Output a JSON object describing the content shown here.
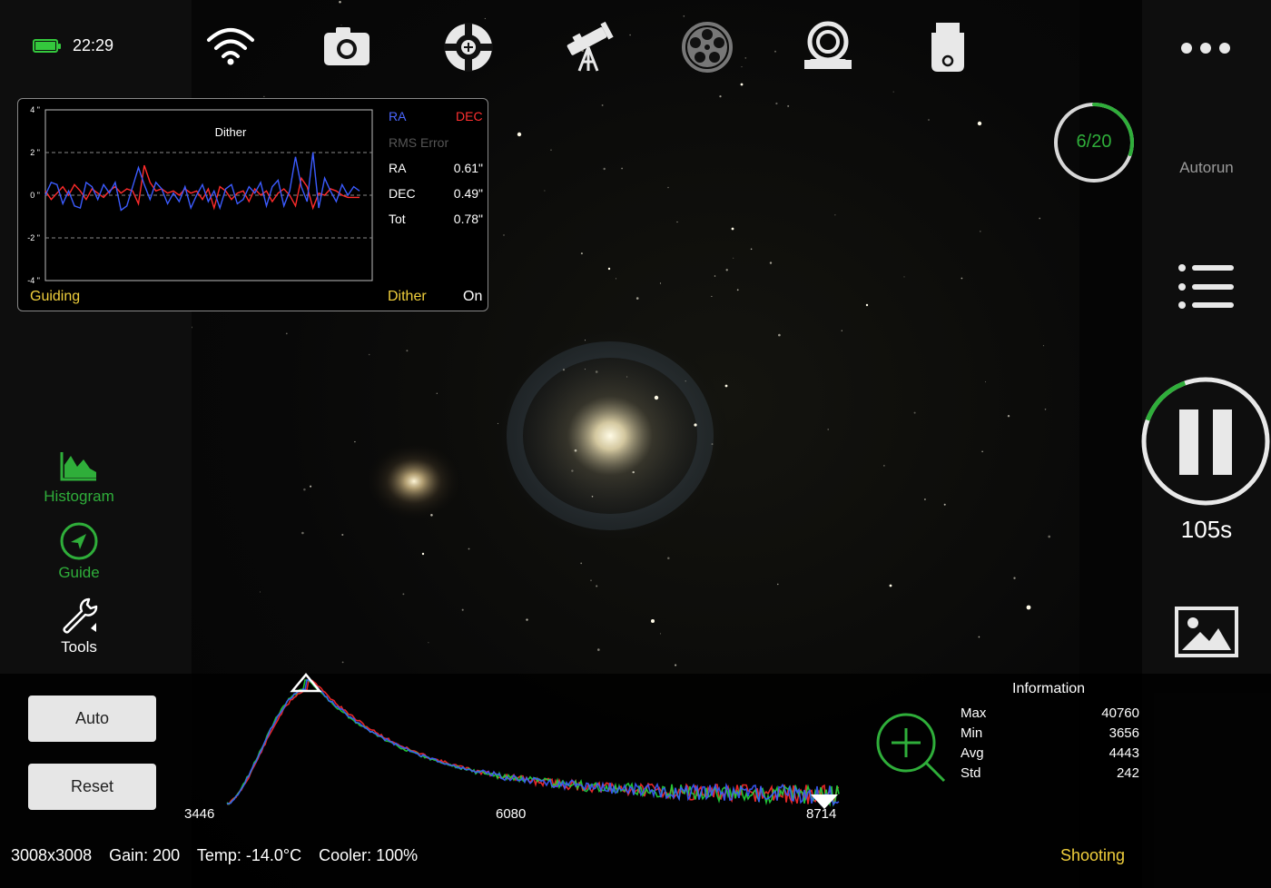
{
  "status_bar": {
    "time": "22:29",
    "battery_color": "#34c83d"
  },
  "top_toolbar": {
    "icons": [
      "wifi-icon",
      "camera-icon",
      "guide-scope-icon",
      "telescope-icon",
      "filter-wheel-icon",
      "focuser-icon",
      "storage-icon"
    ]
  },
  "guiding_panel": {
    "title": "Dither",
    "y_ticks": [
      "4 \"",
      "2 \"",
      "0 \"",
      "-2 \"",
      "-4 \""
    ],
    "legend_ra": "RA",
    "legend_dec": "DEC",
    "rms_label": "RMS Error",
    "rms_rows": [
      {
        "label": "RA",
        "value": "0.61\""
      },
      {
        "label": "DEC",
        "value": "0.49\""
      },
      {
        "label": "Tot",
        "value": "0.78\""
      }
    ],
    "footer_left": "Guiding",
    "footer_dither": "Dither",
    "footer_dither_state": "On",
    "ra_color": "#3b5bff",
    "dec_color": "#ff2b2b",
    "accent_color": "#f0cf3c"
  },
  "chart_data": {
    "type": "line",
    "title": "Dither",
    "ylim": [
      -4,
      4
    ],
    "grid": true,
    "series": [
      {
        "name": "RA",
        "values": [
          0.0,
          0.6,
          0.5,
          -0.4,
          0.2,
          -0.5,
          -0.6,
          0.6,
          0.4,
          -0.2,
          0.5,
          0.1,
          0.6,
          -0.7,
          -0.5,
          0.4,
          1.3,
          0.5,
          -0.2,
          0.6,
          0.3,
          -0.4,
          0.1,
          -0.3,
          0.4,
          -0.6,
          0.0,
          0.5,
          -0.3,
          0.2,
          -0.6,
          0.3,
          0.5,
          -0.4,
          -0.2,
          0.4,
          0.1,
          0.6,
          -0.5,
          0.4,
          0.7,
          -0.5,
          0.2,
          1.8,
          0.4,
          -0.3,
          2.0,
          -0.6,
          0.8,
          0.2,
          -0.3,
          0.5,
          0.0,
          0.4,
          0.2
        ]
      },
      {
        "name": "DEC",
        "values": [
          0.2,
          -0.2,
          0.1,
          0.4,
          0.0,
          0.5,
          0.2,
          -0.2,
          0.3,
          0.1,
          -0.1,
          0.2,
          0.4,
          0.1,
          0.3,
          0.2,
          -0.4,
          1.4,
          0.6,
          0.2,
          0.3,
          0.1,
          0.2,
          0.0,
          0.3,
          0.1,
          0.2,
          -0.2,
          0.3,
          -0.6,
          0.4,
          0.2,
          -0.2,
          0.1,
          0.2,
          -0.3,
          0.3,
          0.0,
          0.2,
          -0.3,
          0.1,
          0.3,
          0.0,
          -0.5,
          0.8,
          0.4,
          -0.6,
          0.1,
          0.0,
          0.3,
          0.2,
          0.0,
          -0.1,
          -0.1,
          -0.1
        ]
      }
    ]
  },
  "left_tools": [
    {
      "label": "Histogram",
      "icon": "histogram-icon",
      "color": "#2fae3a"
    },
    {
      "label": "Guide",
      "icon": "guide-icon",
      "color": "#2fae3a"
    },
    {
      "label": "Tools",
      "icon": "wrench-icon",
      "color": "#ffffff"
    }
  ],
  "buttons": {
    "auto": "Auto",
    "reset": "Reset"
  },
  "histogram": {
    "ticks": [
      "3446",
      "6080",
      "8714"
    ],
    "colors": [
      "#ff2b2b",
      "#22d63a",
      "#3b5bff"
    ]
  },
  "information": {
    "title": "Information",
    "rows": [
      {
        "label": "Max",
        "value": "40760"
      },
      {
        "label": "Min",
        "value": "3656"
      },
      {
        "label": "Avg",
        "value": "4443"
      },
      {
        "label": "Std",
        "value": "242"
      }
    ]
  },
  "right_panel": {
    "progress": "6/20",
    "progress_fraction": 0.3,
    "autorun": "Autorun",
    "exposure_time": "105s",
    "exposure_fraction": 0.14,
    "accent_color": "#2fae3a"
  },
  "status_line": {
    "resolution": "3008x3008",
    "gain": "Gain: 200",
    "temp": "Temp: -14.0°C",
    "cooler": "Cooler: 100%",
    "state": "Shooting"
  }
}
